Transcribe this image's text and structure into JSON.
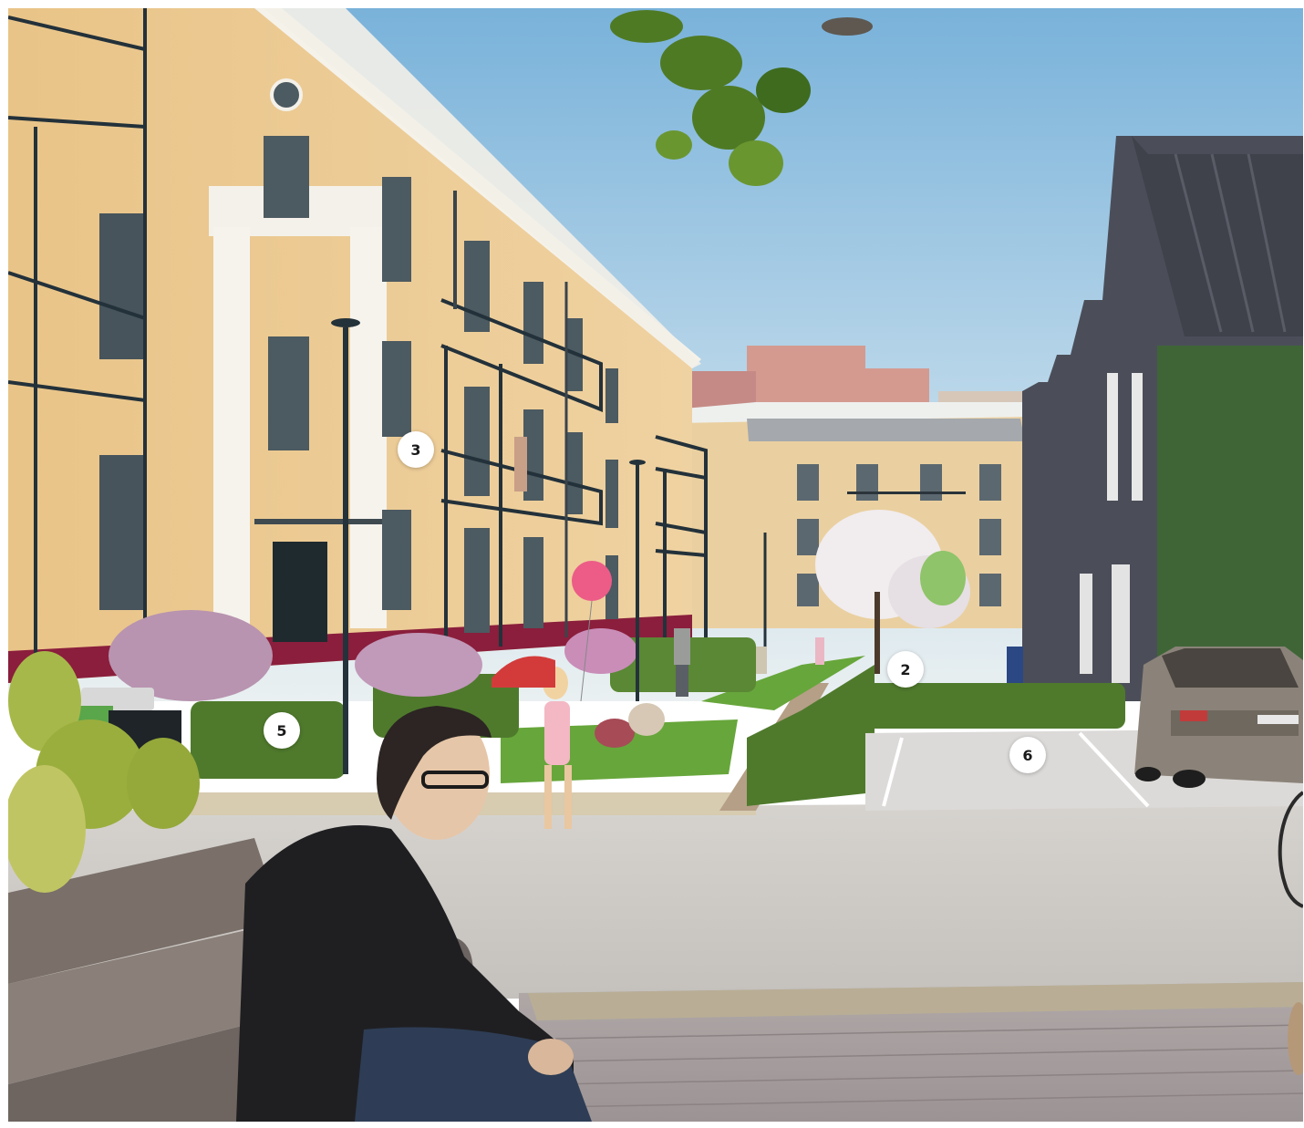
{
  "markers": [
    {
      "id": "m3",
      "label": "3"
    },
    {
      "id": "m2",
      "label": "2"
    },
    {
      "id": "m5",
      "label": "5"
    },
    {
      "id": "m6",
      "label": "6"
    }
  ],
  "colors": {
    "sky_top": "#7fb6dc",
    "sky_bottom": "#e8eef0",
    "facade": "#ecc98f",
    "trim": "#f4f1ea",
    "balcony": "#24323a",
    "brick_building": "#4a4d58",
    "roof": "#3c3f46",
    "hedge": "#4f7a2c",
    "lawn": "#67a63b",
    "road": "#cfcdc8",
    "paving": "#a9a3a2",
    "car": "#8a8278"
  }
}
